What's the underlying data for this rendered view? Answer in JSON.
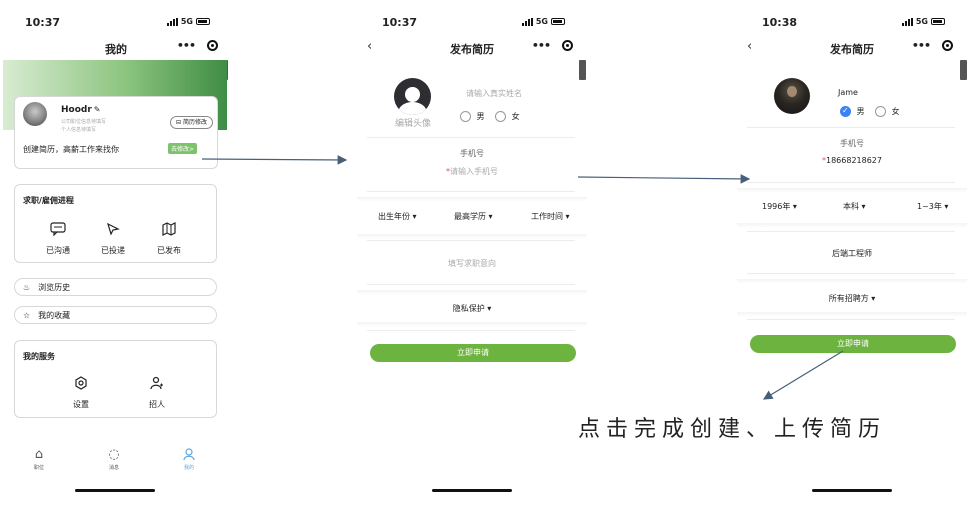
{
  "status": {
    "times": [
      "10:37",
      "10:37",
      "10:38"
    ],
    "network": "5G"
  },
  "screen1": {
    "title": "我的",
    "profile": {
      "name": "Hoodr",
      "line1": "公司职位信息待填写",
      "line2": "个人信息待填写",
      "resume_edit": "简历修改",
      "create_tip": "创建简历，高薪工作来找你",
      "goto": "去修改>"
    },
    "progress": {
      "title": "求职/雇佣进程",
      "items": [
        {
          "label": "已沟通",
          "icon": "chat-icon"
        },
        {
          "label": "已投递",
          "icon": "send-icon"
        },
        {
          "label": "已发布",
          "icon": "map-icon"
        }
      ]
    },
    "history": "浏览历史",
    "favorites": "我的收藏",
    "services": {
      "title": "我的服务",
      "items": [
        {
          "label": "设置",
          "icon": "settings-icon"
        },
        {
          "label": "招人",
          "icon": "recruit-icon"
        }
      ]
    },
    "tabs": [
      {
        "label": "职位",
        "icon": "home-icon"
      },
      {
        "label": "消息",
        "icon": "message-icon"
      },
      {
        "label": "我的",
        "icon": "user-icon"
      }
    ]
  },
  "screen2": {
    "title": "发布简历",
    "edit_avatar": "编辑头像",
    "name_placeholder": "请输入真实姓名",
    "male": "男",
    "female": "女",
    "phone_label": "手机号",
    "phone_placeholder": "请输入手机号",
    "birth_year": "出生年份",
    "education": "最高学历",
    "work_time": "工作时间",
    "intent_placeholder": "填写求职意向",
    "privacy": "隐私保护",
    "submit": "立即申请"
  },
  "screen3": {
    "title": "发布简历",
    "name": "Jame",
    "male": "男",
    "female": "女",
    "phone_label": "手机号",
    "phone_value": "18668218627",
    "birth_year": "1996年",
    "education": "本科",
    "work_time": "1~3年",
    "intent": "后端工程师",
    "privacy": "所有招聘方",
    "submit": "立即申请"
  },
  "caption": "点击完成创建、上传简历",
  "colors": {
    "accent_green": "#6db33f",
    "tab_active": "#5aa9e6",
    "required": "#e05353"
  }
}
